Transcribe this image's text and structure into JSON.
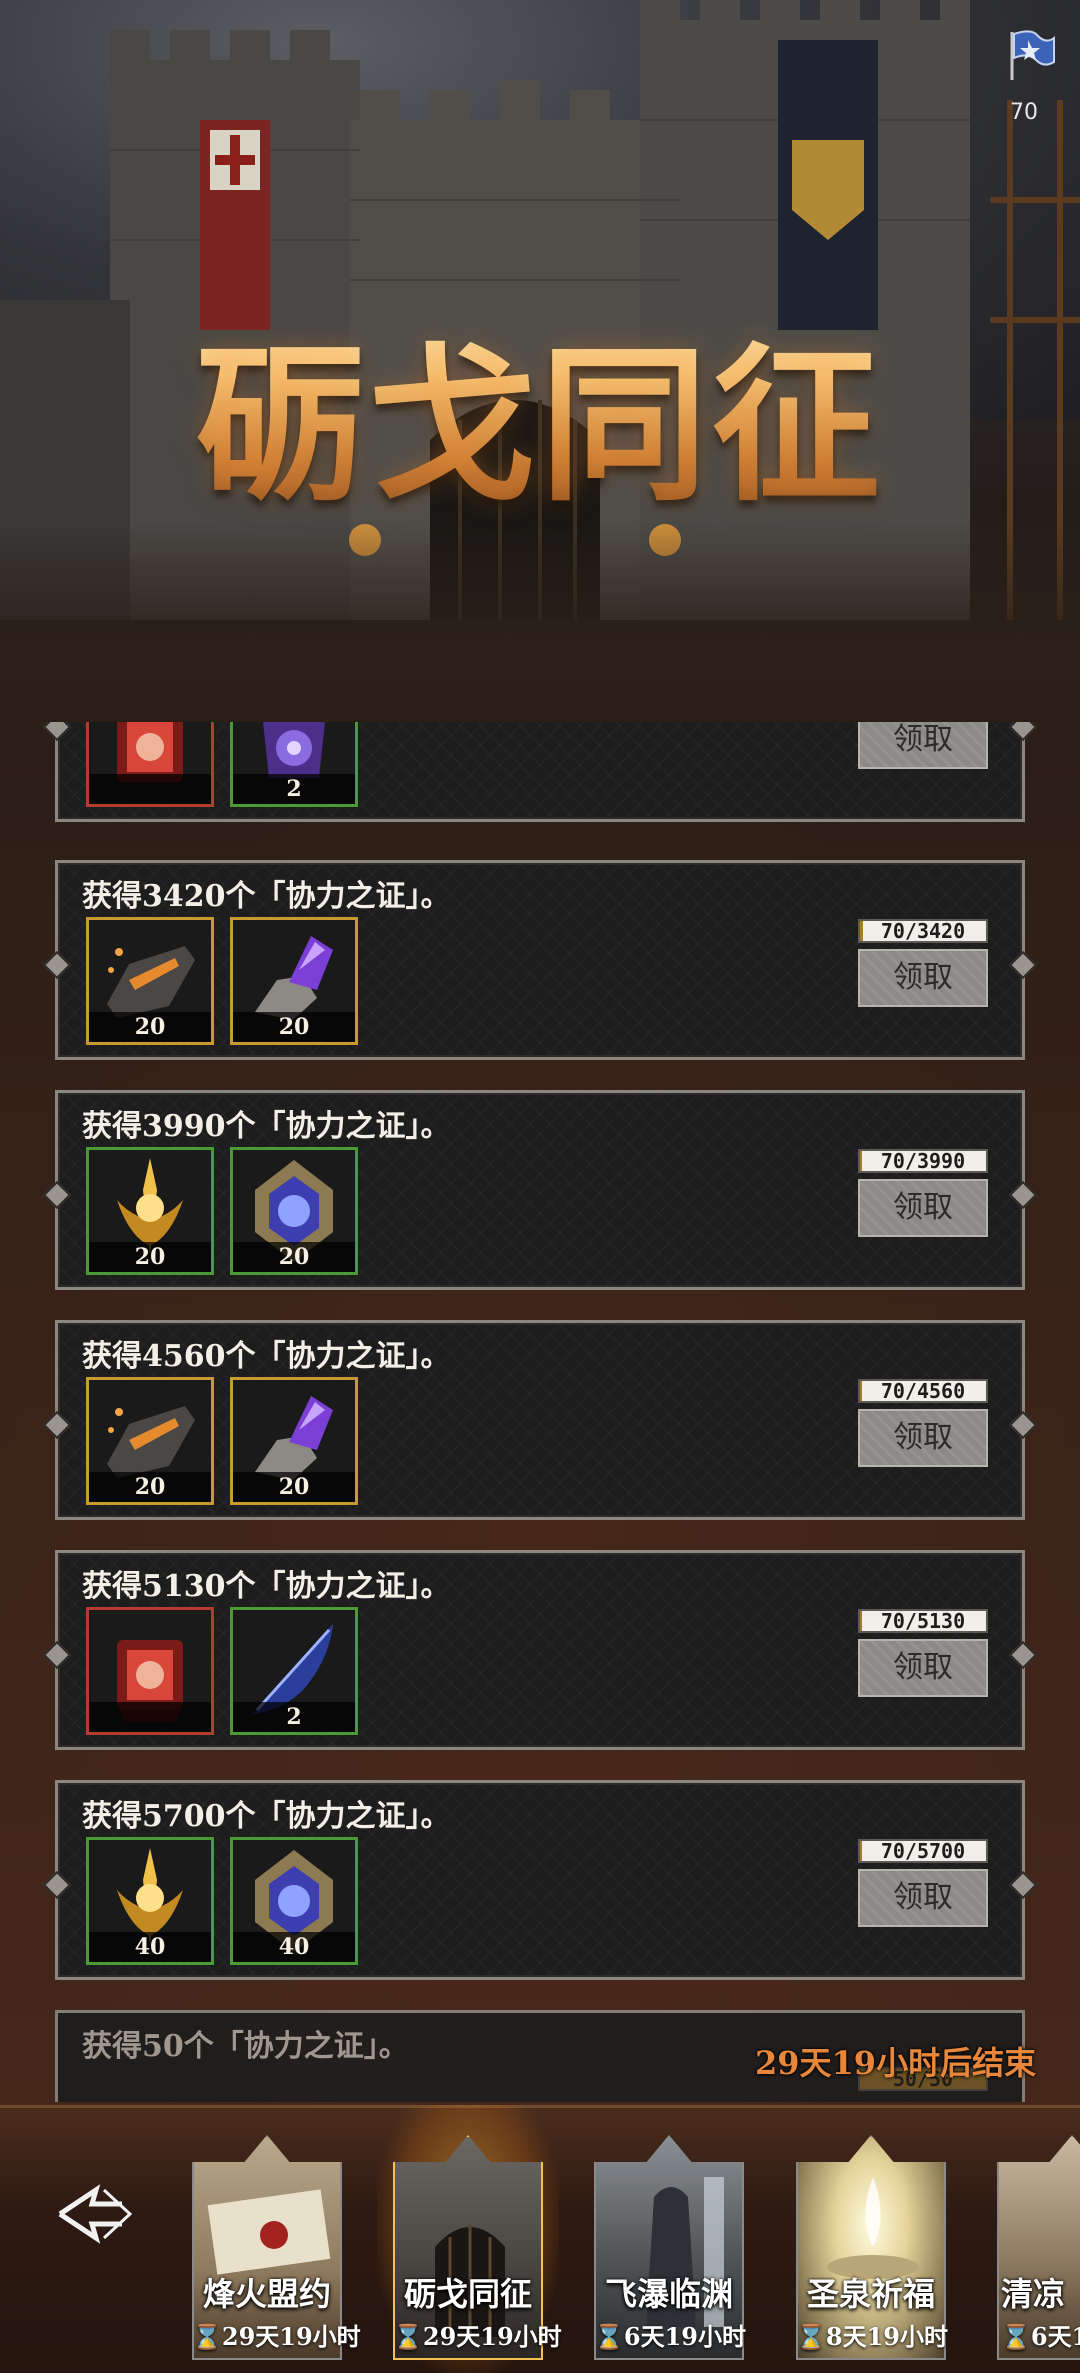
{
  "event": {
    "title": "砺戈同征",
    "flag_count": "70"
  },
  "colors": {
    "gold_border": "#c79b2d",
    "green_border": "#4c9a33",
    "red_border": "#b53a2f",
    "end_text": "#e8873c",
    "active_tab_glow": "#f0a52a"
  },
  "rewards": {
    "partial_top": {
      "items": [
        {
          "icon": "red-gear-chest-icon",
          "rarity": "red",
          "count": ""
        },
        {
          "icon": "purple-gem-bag-icon",
          "rarity": "green",
          "count": "2"
        }
      ],
      "button": "领取"
    },
    "rows": [
      {
        "title": "获得3420个「协力之证」。",
        "progress": "70/3420",
        "fraction": 0.0205,
        "button": "领取",
        "items": [
          {
            "icon": "ember-ore-icon",
            "rarity": "gold",
            "count": "20"
          },
          {
            "icon": "purple-crystal-ore-icon",
            "rarity": "gold",
            "count": "20"
          }
        ]
      },
      {
        "title": "获得3990个「协力之证」。",
        "progress": "70/3990",
        "fraction": 0.0175,
        "button": "领取",
        "items": [
          {
            "icon": "golden-sword-emblem-icon",
            "rarity": "green",
            "count": "20"
          },
          {
            "icon": "blue-gem-emblem-icon",
            "rarity": "green",
            "count": "20"
          }
        ]
      },
      {
        "title": "获得4560个「协力之证」。",
        "progress": "70/4560",
        "fraction": 0.0154,
        "button": "领取",
        "items": [
          {
            "icon": "ember-ore-icon",
            "rarity": "gold",
            "count": "20"
          },
          {
            "icon": "purple-crystal-ore-icon",
            "rarity": "gold",
            "count": "20"
          }
        ]
      },
      {
        "title": "获得5130个「协力之证」。",
        "progress": "70/5130",
        "fraction": 0.0136,
        "button": "领取",
        "items": [
          {
            "icon": "red-gear-chest-icon",
            "rarity": "red",
            "count": ""
          },
          {
            "icon": "blue-feather-icon",
            "rarity": "green",
            "count": "2"
          }
        ]
      },
      {
        "title": "获得5700个「协力之证」。",
        "progress": "70/5700",
        "fraction": 0.0123,
        "button": "领取",
        "items": [
          {
            "icon": "golden-sword-emblem-icon",
            "rarity": "green",
            "count": "40"
          },
          {
            "icon": "blue-gem-emblem-icon",
            "rarity": "green",
            "count": "40"
          }
        ]
      }
    ],
    "tail": {
      "title": "获得50个「协力之证」。",
      "progress": "50/50"
    },
    "end_notice": "29天19小时后结束"
  },
  "nav": {
    "back_icon": "crossed-arrows-back-icon",
    "tabs": [
      {
        "label": "烽火盟约",
        "time": "29天19小时",
        "art": "sealed-letter-art",
        "active": false
      },
      {
        "label": "砺戈同征",
        "time": "29天19小时",
        "art": "castle-gate-art",
        "active": true
      },
      {
        "label": "飞瀑临渊",
        "time": "6天19小时",
        "art": "waterfall-figure-art",
        "active": false
      },
      {
        "label": "圣泉祈福",
        "time": "8天19小时",
        "art": "holy-fountain-art",
        "active": false
      },
      {
        "label": "清凉",
        "time": "6天1",
        "art": "partial-tab-art",
        "active": false
      }
    ]
  }
}
